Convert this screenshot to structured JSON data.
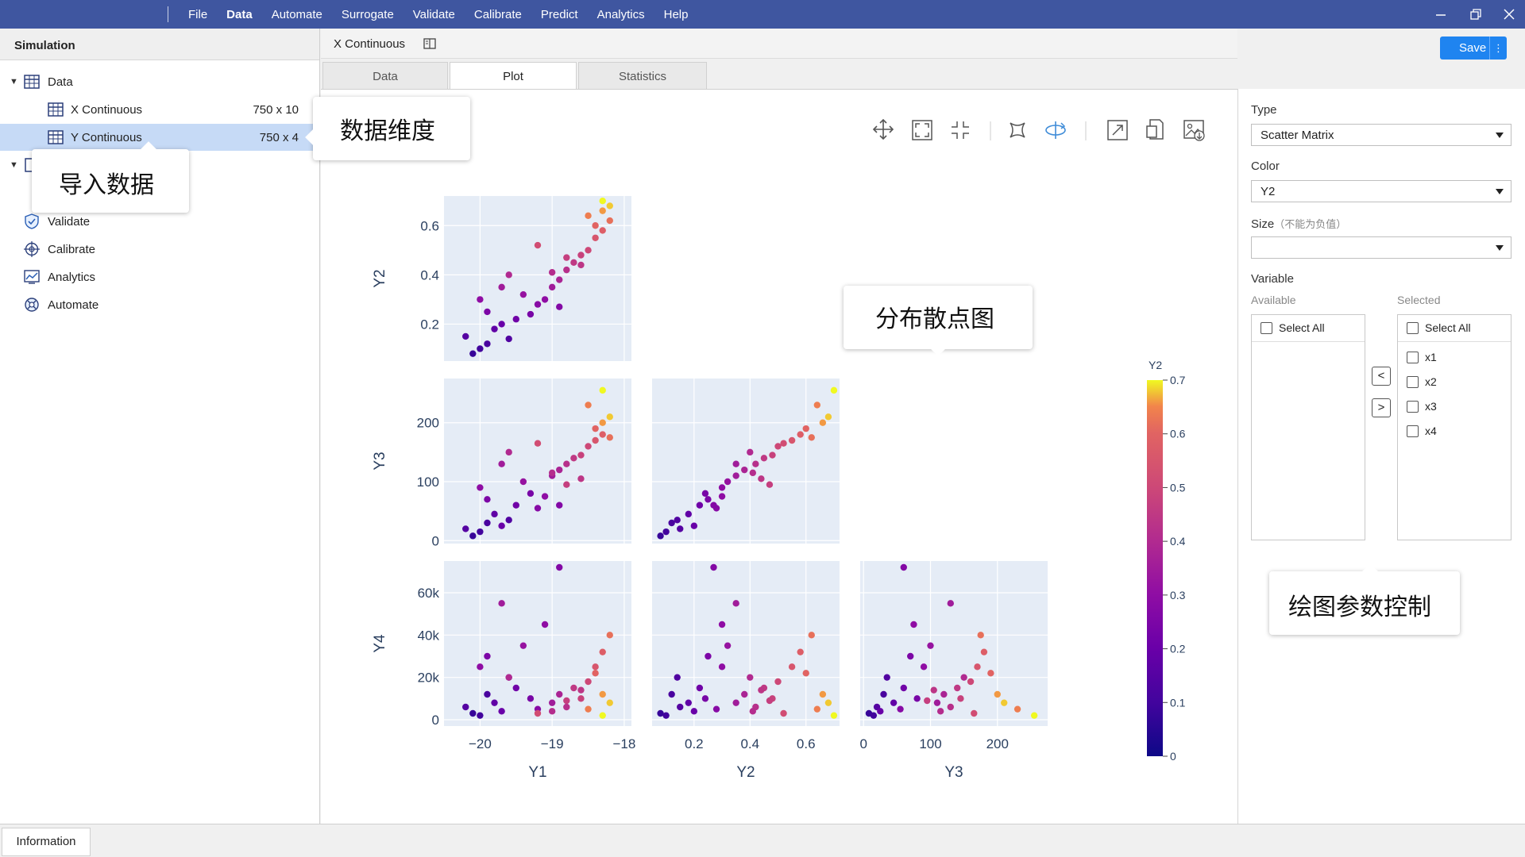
{
  "menu": [
    "File",
    "Data",
    "Automate",
    "Surrogate",
    "Validate",
    "Calibrate",
    "Predict",
    "Analytics",
    "Help"
  ],
  "menu_active": "Data",
  "left_panel": {
    "title": "Simulation",
    "tree": {
      "data_label": "Data",
      "x_continuous": {
        "label": "X Continuous",
        "dims": "750 x 10"
      },
      "y_continuous": {
        "label": "Y Continuous",
        "dims": "750 x 4"
      },
      "validate": "Validate",
      "calibrate": "Calibrate",
      "analytics": "Analytics",
      "automate": "Automate"
    }
  },
  "doc": {
    "title": "X Continuous"
  },
  "tabs": {
    "data": "Data",
    "plot": "Plot",
    "statistics": "Statistics"
  },
  "save": {
    "label": "Save",
    "more": "⋮"
  },
  "right_panel": {
    "type_label": "Type",
    "type_value": "Scatter Matrix",
    "color_label": "Color",
    "color_value": "Y2",
    "size_label": "Size",
    "size_note": "（不能为负值）",
    "size_value": "",
    "variable_label": "Variable",
    "available_label": "Available",
    "selected_label": "Selected",
    "select_all": "Select All",
    "selected_items": [
      "x1",
      "x2",
      "x3",
      "x4"
    ],
    "move_left": "<",
    "move_right": ">"
  },
  "bottom": {
    "info_tab": "Information"
  },
  "callouts": {
    "dims": "数据维度",
    "import": "导入数据",
    "scatter": "分布散点图",
    "controls": "绘图参数控制"
  },
  "toolbar_icons": [
    "pan-icon",
    "zoom-in-icon",
    "zoom-out-icon",
    "autoscale-icon",
    "reset-icon",
    "expand-icon",
    "export-icon",
    "download-image-icon"
  ],
  "chart_data": {
    "type": "scatter",
    "subtype": "scatter-matrix",
    "variables": [
      "Y1",
      "Y2",
      "Y3",
      "Y4"
    ],
    "color_variable": "Y2",
    "colorscale": "plasma",
    "colorbar": {
      "title": "Y2",
      "range": [
        0,
        0.7
      ],
      "ticks": [
        "0",
        "0.1",
        "0.2",
        "0.3",
        "0.4",
        "0.5",
        "0.6",
        "0.7"
      ]
    },
    "axes": {
      "Y1": {
        "range": [
          -20.5,
          -17.9
        ],
        "ticks": [
          -20,
          -19,
          -18
        ],
        "tick_labels": [
          "−20",
          "−19",
          "−18"
        ]
      },
      "Y2": {
        "range": [
          0.05,
          0.72
        ],
        "ticks": [
          0.2,
          0.4,
          0.6
        ],
        "tick_labels": [
          "0.2",
          "0.4",
          "0.6"
        ]
      },
      "Y3": {
        "range": [
          -5,
          275
        ],
        "ticks": [
          0,
          100,
          200
        ],
        "tick_labels": [
          "0",
          "100",
          "200"
        ]
      },
      "Y4": {
        "range": [
          -3000,
          75000
        ],
        "ticks": [
          0,
          20000,
          40000,
          60000
        ],
        "tick_labels": [
          "0",
          "20k",
          "40k",
          "60k"
        ]
      }
    },
    "grid": true,
    "legend": "colorbar-right",
    "panels": [
      {
        "x": "Y1",
        "y": "Y2"
      },
      {
        "x": "Y1",
        "y": "Y3"
      },
      {
        "x": "Y2",
        "y": "Y3"
      },
      {
        "x": "Y1",
        "y": "Y4"
      },
      {
        "x": "Y2",
        "y": "Y4"
      },
      {
        "x": "Y3",
        "y": "Y4"
      }
    ],
    "samples": [
      {
        "Y1": -20.1,
        "Y2": 0.08,
        "Y3": 8,
        "Y4": 3000
      },
      {
        "Y1": -20.0,
        "Y2": 0.1,
        "Y3": 15,
        "Y4": 2000
      },
      {
        "Y1": -20.2,
        "Y2": 0.15,
        "Y3": 20,
        "Y4": 6000
      },
      {
        "Y1": -19.9,
        "Y2": 0.12,
        "Y3": 30,
        "Y4": 12000
      },
      {
        "Y1": -19.8,
        "Y2": 0.18,
        "Y3": 45,
        "Y4": 8000
      },
      {
        "Y1": -19.7,
        "Y2": 0.2,
        "Y3": 25,
        "Y4": 4000
      },
      {
        "Y1": -19.6,
        "Y2": 0.14,
        "Y3": 35,
        "Y4": 20000
      },
      {
        "Y1": -19.5,
        "Y2": 0.22,
        "Y3": 60,
        "Y4": 15000
      },
      {
        "Y1": -19.9,
        "Y2": 0.25,
        "Y3": 70,
        "Y4": 30000
      },
      {
        "Y1": -20.0,
        "Y2": 0.3,
        "Y3": 90,
        "Y4": 25000
      },
      {
        "Y1": -19.3,
        "Y2": 0.24,
        "Y3": 80,
        "Y4": 10000
      },
      {
        "Y1": -19.2,
        "Y2": 0.28,
        "Y3": 55,
        "Y4": 5000
      },
      {
        "Y1": -19.4,
        "Y2": 0.32,
        "Y3": 100,
        "Y4": 35000
      },
      {
        "Y1": -19.0,
        "Y2": 0.35,
        "Y3": 110,
        "Y4": 8000
      },
      {
        "Y1": -18.9,
        "Y2": 0.38,
        "Y3": 120,
        "Y4": 12000
      },
      {
        "Y1": -19.1,
        "Y2": 0.3,
        "Y3": 75,
        "Y4": 45000
      },
      {
        "Y1": -18.8,
        "Y2": 0.42,
        "Y3": 130,
        "Y4": 6000
      },
      {
        "Y1": -18.7,
        "Y2": 0.45,
        "Y3": 140,
        "Y4": 15000
      },
      {
        "Y1": -19.6,
        "Y2": 0.4,
        "Y3": 150,
        "Y4": 20000
      },
      {
        "Y1": -18.6,
        "Y2": 0.48,
        "Y3": 145,
        "Y4": 10000
      },
      {
        "Y1": -18.5,
        "Y2": 0.5,
        "Y3": 160,
        "Y4": 18000
      },
      {
        "Y1": -18.4,
        "Y2": 0.55,
        "Y3": 170,
        "Y4": 25000
      },
      {
        "Y1": -18.3,
        "Y2": 0.58,
        "Y3": 180,
        "Y4": 32000
      },
      {
        "Y1": -18.2,
        "Y2": 0.62,
        "Y3": 175,
        "Y4": 40000
      },
      {
        "Y1": -18.3,
        "Y2": 0.66,
        "Y3": 200,
        "Y4": 12000
      },
      {
        "Y1": -18.2,
        "Y2": 0.68,
        "Y3": 210,
        "Y4": 8000
      },
      {
        "Y1": -18.4,
        "Y2": 0.6,
        "Y3": 190,
        "Y4": 22000
      },
      {
        "Y1": -18.5,
        "Y2": 0.64,
        "Y3": 230,
        "Y4": 5000
      },
      {
        "Y1": -18.3,
        "Y2": 0.7,
        "Y3": 255,
        "Y4": 2000
      },
      {
        "Y1": -19.2,
        "Y2": 0.52,
        "Y3": 165,
        "Y4": 3000
      },
      {
        "Y1": -19.7,
        "Y2": 0.35,
        "Y3": 130,
        "Y4": 55000
      },
      {
        "Y1": -18.9,
        "Y2": 0.27,
        "Y3": 60,
        "Y4": 72000
      },
      {
        "Y1": -18.6,
        "Y2": 0.44,
        "Y3": 105,
        "Y4": 14000
      },
      {
        "Y1": -18.8,
        "Y2": 0.47,
        "Y3": 95,
        "Y4": 9000
      },
      {
        "Y1": -19.0,
        "Y2": 0.41,
        "Y3": 115,
        "Y4": 4000
      }
    ]
  }
}
